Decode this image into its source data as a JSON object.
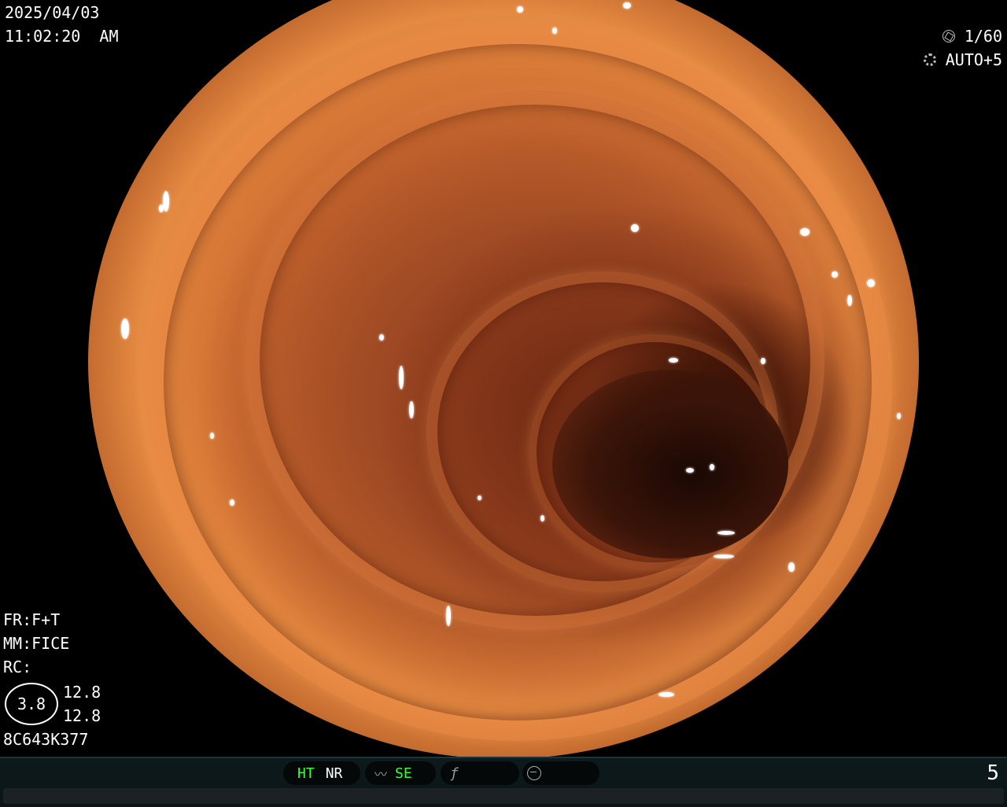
{
  "header": {
    "date": "2025/04/03",
    "time": "11:02:20  AM",
    "shutter": "1/60",
    "exposure": "AUTO+5",
    "shutter_icon": "aperture-icon",
    "exposure_icon": "gear-icon"
  },
  "settings": {
    "fr": "FR:F+T",
    "mm": "MM:FICE",
    "rc": "RC:",
    "zoom_value": "3.8",
    "value_a": "12.8",
    "value_b": "12.8",
    "serial": "8C643K377"
  },
  "status_bar": {
    "ht_label": "HT",
    "nr_label": "NR",
    "se_label": "SE",
    "page_number": "5",
    "accent_color": "#33ff33"
  }
}
